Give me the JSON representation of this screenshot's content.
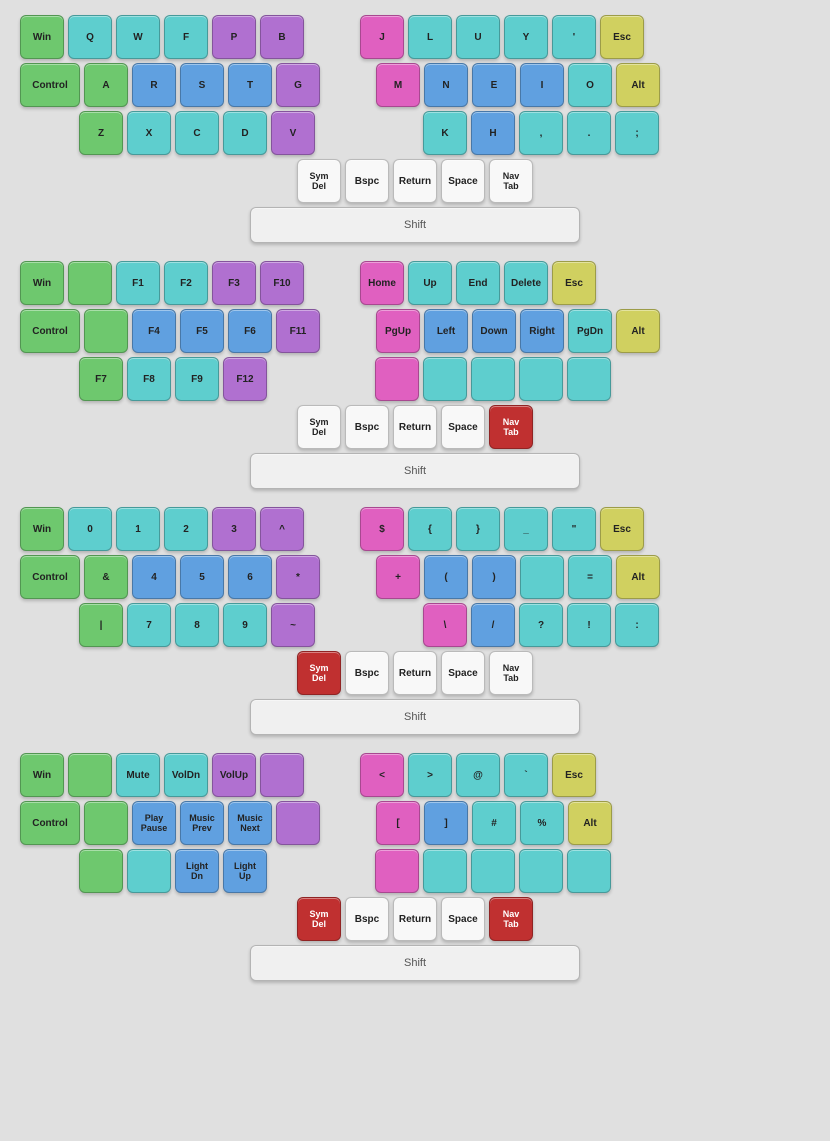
{
  "sections": [
    {
      "id": "section1",
      "rows": [
        {
          "left": [
            "Win",
            "Q",
            "W",
            "F",
            "P",
            "B"
          ],
          "right": [
            "J",
            "L",
            "U",
            "Y",
            "'",
            "Esc"
          ]
        },
        {
          "left": [
            "Control",
            "A",
            "R",
            "S",
            "T",
            "G"
          ],
          "right": [
            "M",
            "N",
            "E",
            "I",
            "O",
            "Alt"
          ]
        },
        {
          "left_indent": true,
          "left": [
            "Z",
            "X",
            "C",
            "D",
            "V"
          ],
          "right": [
            "K",
            "H",
            ",",
            ".",
            ";"
          ]
        }
      ],
      "bottom": [
        "Sym\nDel",
        "Bspc",
        "Return",
        "Space",
        "Nav\nTab"
      ],
      "shift": "Shift",
      "bottom_red": []
    },
    {
      "id": "section2",
      "rows": [
        {
          "left": [
            "Win",
            "",
            "F1",
            "F2",
            "F3",
            "F10"
          ],
          "right": [
            "Home",
            "Up",
            "End",
            "Delete",
            "Esc"
          ]
        },
        {
          "left": [
            "Control",
            "",
            "F4",
            "F5",
            "F6",
            "F11"
          ],
          "right": [
            "PgUp",
            "Left",
            "Down",
            "Right",
            "PgDn",
            "Alt"
          ]
        },
        {
          "left_indent": true,
          "left": [
            "F7",
            "F8",
            "F9",
            "F12"
          ],
          "right": [
            "",
            "",
            "",
            "",
            ""
          ]
        }
      ],
      "bottom": [
        "Sym\nDel",
        "Bspc",
        "Return",
        "Space",
        "Nav\nTab"
      ],
      "shift": "Shift",
      "bottom_red": [
        "Nav\nTab"
      ]
    },
    {
      "id": "section3",
      "rows": [
        {
          "left": [
            "Win",
            "0",
            "1",
            "2",
            "3",
            "^"
          ],
          "right": [
            "$",
            "{",
            "}",
            "_",
            "\"",
            "Esc"
          ]
        },
        {
          "left": [
            "Control",
            "&",
            "4",
            "5",
            "6",
            "*"
          ],
          "right": [
            "+",
            "(",
            ")",
            " ",
            "=",
            "Alt"
          ]
        },
        {
          "left_indent": true,
          "left": [
            "|",
            "7",
            "8",
            "9",
            "~"
          ],
          "right": [
            "\\",
            "/",
            "?",
            "!",
            " :"
          ]
        }
      ],
      "bottom": [
        "Sym\nDel",
        "Bspc",
        "Return",
        "Space",
        "Nav\nTab"
      ],
      "shift": "Shift",
      "bottom_red": [
        "Sym\nDel"
      ]
    },
    {
      "id": "section4",
      "rows": [
        {
          "left": [
            "Win",
            "",
            "Mute",
            "VolDn",
            "VolUp",
            ""
          ],
          "right": [
            "<",
            ">",
            "@",
            "`",
            "Esc"
          ]
        },
        {
          "left": [
            "Control",
            "",
            "Play\nPause",
            "Music\nPrev",
            "Music\nNext",
            ""
          ],
          "right": [
            "[",
            "]",
            "#",
            "%",
            "Alt"
          ]
        },
        {
          "left_indent": true,
          "left": [
            "",
            "",
            "Light\nDn",
            "Light\nUp"
          ],
          "right": [
            "",
            "",
            "",
            "",
            ""
          ]
        }
      ],
      "bottom": [
        "Sym\nDel",
        "Bspc",
        "Return",
        "Space",
        "Nav\nTab"
      ],
      "shift": "Shift",
      "bottom_red": [
        "Sym\nDel",
        "Nav\nTab"
      ]
    }
  ]
}
